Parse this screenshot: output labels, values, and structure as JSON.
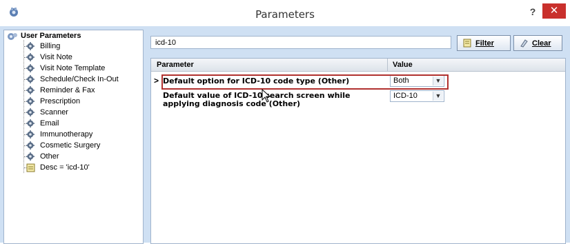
{
  "window": {
    "title": "Parameters",
    "help_label": "?",
    "close_label": "✕"
  },
  "tree": {
    "root_label": "User Parameters",
    "items": [
      {
        "label": "Billing",
        "icon": "gear-icon"
      },
      {
        "label": "Visit Note",
        "icon": "gear-icon"
      },
      {
        "label": "Visit Note Template",
        "icon": "gear-icon"
      },
      {
        "label": "Schedule/Check In-Out",
        "icon": "gear-icon"
      },
      {
        "label": "Reminder & Fax",
        "icon": "gear-icon"
      },
      {
        "label": "Prescription",
        "icon": "gear-icon"
      },
      {
        "label": "Scanner",
        "icon": "gear-icon"
      },
      {
        "label": "Email",
        "icon": "gear-icon"
      },
      {
        "label": "Immunotherapy",
        "icon": "gear-icon"
      },
      {
        "label": "Cosmetic Surgery",
        "icon": "gear-icon"
      },
      {
        "label": "Other",
        "icon": "gear-icon"
      },
      {
        "label": "Desc = 'icd-10'",
        "icon": "filter-note-icon"
      }
    ]
  },
  "search": {
    "value": "icd-10",
    "filter_label": "Filter",
    "clear_label": "Clear"
  },
  "grid": {
    "columns": [
      "Parameter",
      "Value"
    ],
    "rows": [
      {
        "indicator": ">",
        "parameter": "Default option for ICD-10 code type (Other)",
        "value": "Both"
      },
      {
        "indicator": "",
        "parameter": "Default value of ICD-10 search screen while applying diagnosis code (Other)",
        "value": "ICD-10"
      }
    ]
  },
  "colors": {
    "background": "#cfe0f3",
    "highlight_border": "#b0302e",
    "close_button": "#c9302c"
  }
}
